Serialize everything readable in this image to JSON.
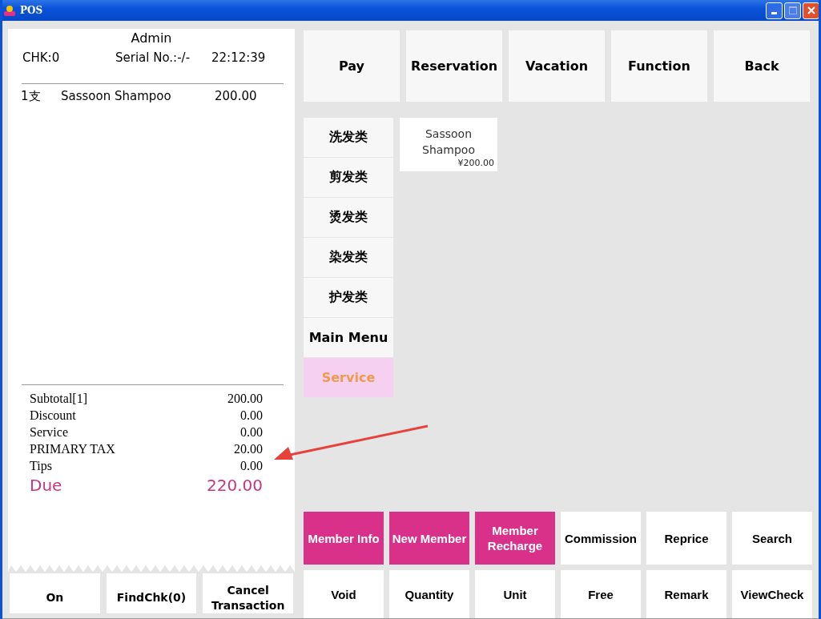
{
  "window": {
    "title": "POS"
  },
  "receipt": {
    "operator": "Admin",
    "check": "CHK:0",
    "serial": "Serial No.:-/-",
    "time": "22:12:39",
    "items": [
      {
        "qty": "1支",
        "name": "Sassoon Shampoo",
        "amount": "200.00"
      }
    ],
    "totals": [
      {
        "label": "Subtotal[1]",
        "value": "200.00"
      },
      {
        "label": "Discount",
        "value": "0.00"
      },
      {
        "label": "Service",
        "value": "0.00"
      },
      {
        "label": "PRIMARY TAX",
        "value": "20.00"
      },
      {
        "label": "Tips",
        "value": "0.00"
      }
    ],
    "due": {
      "label": "Due",
      "value": "220.00"
    }
  },
  "receipt_buttons": [
    "On",
    "FindChk(0)",
    "Cancel Transaction"
  ],
  "top_buttons": [
    "Pay",
    "Reservation",
    "Vacation",
    "Function",
    "Back"
  ],
  "categories": [
    {
      "label": "洗发类",
      "selected": false
    },
    {
      "label": "剪发类",
      "selected": false
    },
    {
      "label": "烫发类",
      "selected": false
    },
    {
      "label": "染发类",
      "selected": false
    },
    {
      "label": "护发类",
      "selected": false
    },
    {
      "label": "Main Menu",
      "selected": false
    },
    {
      "label": "Service",
      "selected": true
    }
  ],
  "products": [
    {
      "name": "Sassoon Shampoo",
      "price": "¥200.00"
    }
  ],
  "function_buttons": [
    {
      "label": "Member Info",
      "highlighted": true
    },
    {
      "label": "New Member",
      "highlighted": true
    },
    {
      "label": "Member Recharge",
      "highlighted": true
    },
    {
      "label": "Commission",
      "highlighted": false
    },
    {
      "label": "Reprice",
      "highlighted": false
    },
    {
      "label": "Search",
      "highlighted": false
    },
    {
      "label": "Void",
      "highlighted": false
    },
    {
      "label": "Quantity",
      "highlighted": false
    },
    {
      "label": "Unit",
      "highlighted": false
    },
    {
      "label": "Free",
      "highlighted": false
    },
    {
      "label": "Remark",
      "highlighted": false
    },
    {
      "label": "ViewCheck",
      "highlighted": false
    }
  ]
}
